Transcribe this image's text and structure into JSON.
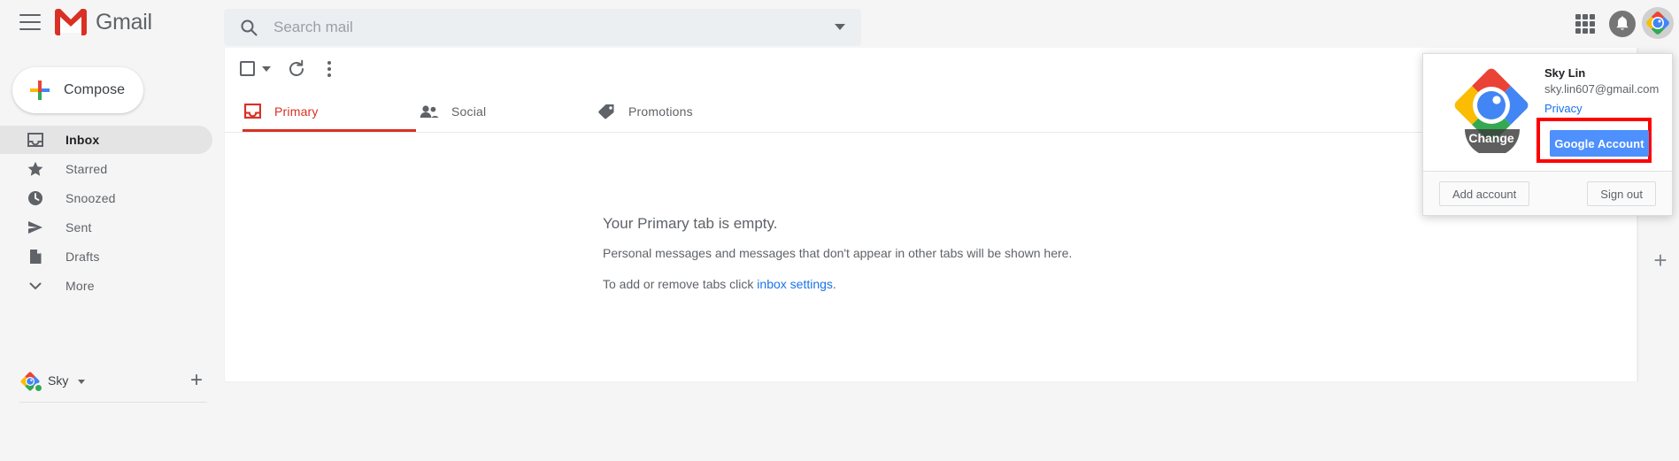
{
  "app": {
    "name": "Gmail"
  },
  "topbar": {
    "menu_icon": "hamburger-menu-icon",
    "logo_icon": "gmail-envelope-logo",
    "brand": "Gmail",
    "search": {
      "placeholder": "Search mail",
      "value": "",
      "icon": "search-icon",
      "options_icon": "chevron-down-icon"
    },
    "apps_icon": "google-apps-grid-icon",
    "notifications_icon": "bell-icon",
    "avatar_icon": "user-avatar-chrome-diamond"
  },
  "sidebar": {
    "compose": {
      "label": "Compose",
      "icon": "plus-icon"
    },
    "items": [
      {
        "label": "Inbox",
        "icon": "inbox-icon",
        "active": true
      },
      {
        "label": "Starred",
        "icon": "star-icon",
        "active": false
      },
      {
        "label": "Snoozed",
        "icon": "clock-icon",
        "active": false
      },
      {
        "label": "Sent",
        "icon": "send-icon",
        "active": false
      },
      {
        "label": "Drafts",
        "icon": "document-icon",
        "active": false
      },
      {
        "label": "More",
        "icon": "chevron-down-icon",
        "active": false
      }
    ],
    "hangouts": {
      "name": "Sky",
      "status": "online",
      "caret_icon": "chevron-down-icon",
      "add_icon": "plus-icon"
    }
  },
  "toolbar": {
    "select_all_icon": "checkbox-icon",
    "select_all_caret_icon": "chevron-down-icon",
    "refresh_icon": "refresh-icon",
    "more_icon": "vertical-dots-icon"
  },
  "tabs": [
    {
      "label": "Primary",
      "icon": "inbox-icon",
      "active": true
    },
    {
      "label": "Social",
      "icon": "people-icon",
      "active": false
    },
    {
      "label": "Promotions",
      "icon": "tag-icon",
      "active": false
    }
  ],
  "empty_state": {
    "title": "Your Primary tab is empty.",
    "line2": "Personal messages and messages that don't appear in other tabs will be shown here.",
    "line3_prefix": "To add or remove tabs click ",
    "line3_link": "inbox settings",
    "line3_suffix": "."
  },
  "addons": {
    "add_icon": "plus-icon"
  },
  "account_popup": {
    "avatar_icon": "chrome-diamond-avatar",
    "avatar_change_label": "Change",
    "name": "Sky Lin",
    "email": "sky.lin607@gmail.com",
    "privacy_label": "Privacy",
    "google_account_label": "Google Account",
    "add_account_label": "Add account",
    "sign_out_label": "Sign out",
    "highlight_color": "#ff0000"
  }
}
